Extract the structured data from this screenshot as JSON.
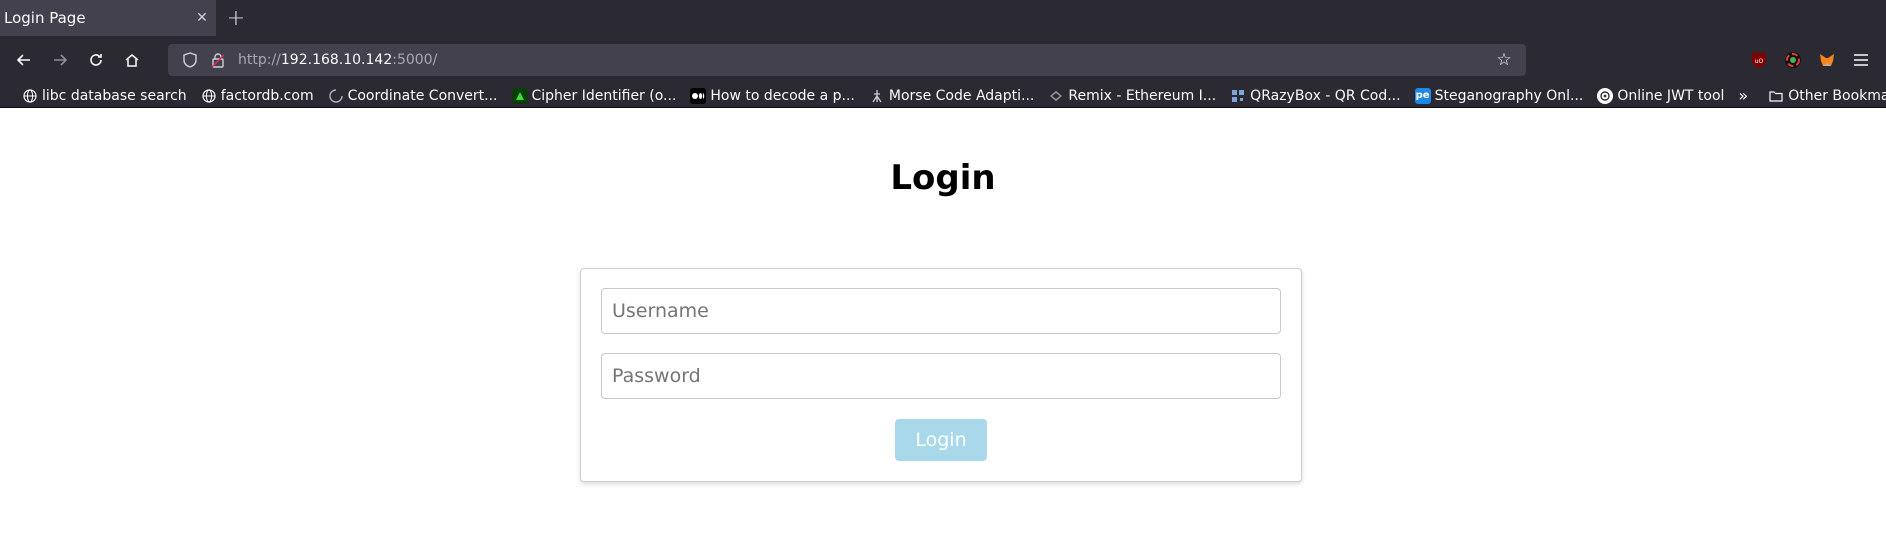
{
  "browser": {
    "tab": {
      "title": "Login Page",
      "close_glyph": "✕"
    },
    "new_tab_glyph": "+",
    "url": {
      "prefix": "http://",
      "host": "192.168.10.142",
      "suffix": ":5000/"
    },
    "bookmarks": [
      {
        "label": "libc database search",
        "icon": "globe-icon"
      },
      {
        "label": "factordb.com",
        "icon": "globe-icon"
      },
      {
        "label": "Coordinate Convert...",
        "icon": "loading-icon"
      },
      {
        "label": "Cipher Identifier (o...",
        "icon": "dcode-icon"
      },
      {
        "label": "How to decode a p...",
        "icon": "medium-icon"
      },
      {
        "label": "Morse Code Adapti...",
        "icon": "morse-icon"
      },
      {
        "label": "Remix - Ethereum I...",
        "icon": "remix-icon"
      },
      {
        "label": "QRazyBox - QR Cod...",
        "icon": "qr-icon"
      },
      {
        "label": "Steganography Onl...",
        "icon": "stego-icon"
      },
      {
        "label": "Online JWT tool",
        "icon": "jwt-icon"
      }
    ],
    "other_bookmarks": "Other Bookmarks"
  },
  "page": {
    "heading": "Login",
    "username_placeholder": "Username",
    "password_placeholder": "Password",
    "login_button": "Login"
  },
  "colors": {
    "chrome_bg": "#2b2a33",
    "tab_active": "#42414d",
    "button_bg": "#a8d8ea"
  }
}
